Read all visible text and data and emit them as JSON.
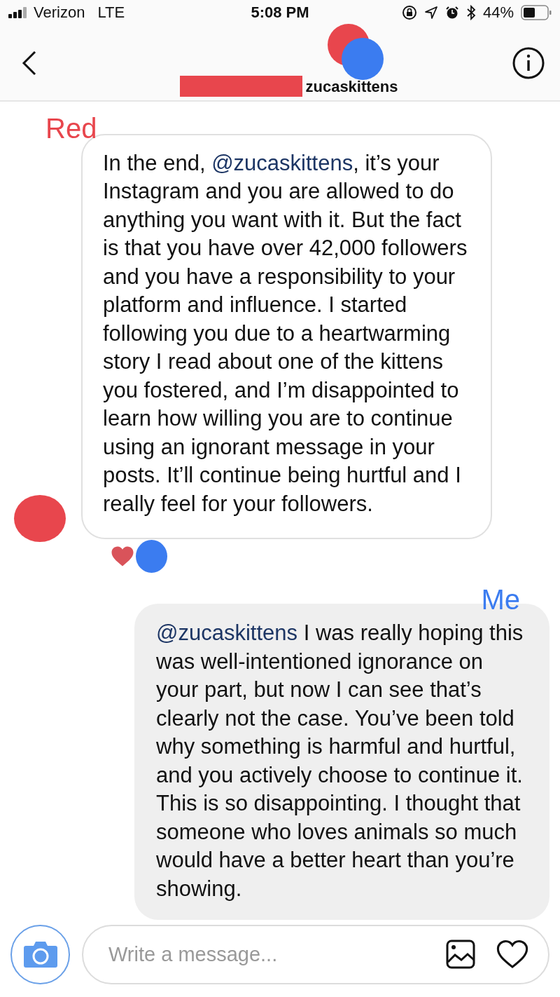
{
  "status_bar": {
    "carrier": "Verizon",
    "network": "LTE",
    "time": "5:08 PM",
    "battery": "44%"
  },
  "header": {
    "username": "zucaskittens"
  },
  "messages": [
    {
      "kind": "received",
      "annotation": "Red",
      "before": "In the end, ",
      "mention": "@zucaskittens",
      "after": ", it’s your Instagram and you are allowed to do anything you want with it. But the fact is that you have over 42,000 followers and you have a responsibility to your platform and influence. I started following you due to a heartwarming story I read about one of the kittens you fostered, and I’m disappointed to learn how willing you are to continue using an ignorant message in your posts. It’ll continue being hurtful and I really feel for your followers.",
      "liked": true
    },
    {
      "kind": "sent",
      "annotation": "Me",
      "mention": "@zucaskittens",
      "after": " I was really hoping this was well-intentioned ignorance on your part, but now I can see that’s clearly not the case. You’ve been told why something is harmful and hurtful, and you actively choose to continue it. This is so disappointing. I thought that someone who loves animals so much would have a better heart than you’re showing."
    }
  ],
  "composer": {
    "placeholder": "Write a message..."
  }
}
